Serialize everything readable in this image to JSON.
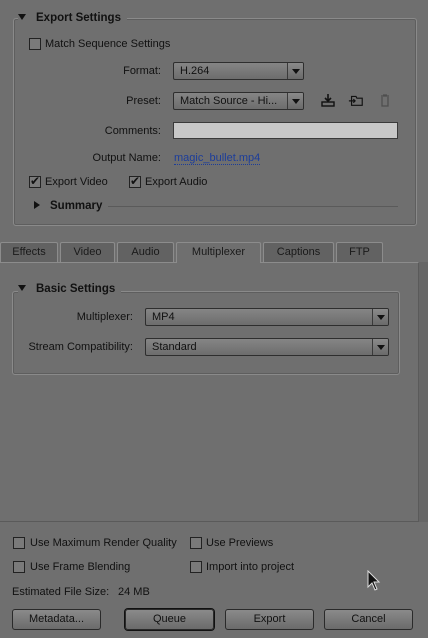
{
  "export_settings": {
    "title": "Export Settings",
    "match_sequence_label": "Match Sequence Settings",
    "match_sequence_checked": false,
    "format_label": "Format:",
    "format_value": "H.264",
    "preset_label": "Preset:",
    "preset_value": "Match Source - Hi...",
    "comments_label": "Comments:",
    "comments_value": "",
    "output_name_label": "Output Name:",
    "output_name_value": "magic_bullet.mp4",
    "export_video_label": "Export Video",
    "export_video_checked": true,
    "export_audio_label": "Export Audio",
    "export_audio_checked": true,
    "summary_label": "Summary"
  },
  "tabs": [
    {
      "label": "Effects",
      "active": false
    },
    {
      "label": "Video",
      "active": false
    },
    {
      "label": "Audio",
      "active": false
    },
    {
      "label": "Multiplexer",
      "active": true
    },
    {
      "label": "Captions",
      "active": false
    },
    {
      "label": "FTP",
      "active": false
    }
  ],
  "basic_settings": {
    "title": "Basic Settings",
    "multiplexer_label": "Multiplexer:",
    "multiplexer_value": "MP4",
    "stream_label": "Stream Compatibility:",
    "stream_value": "Standard"
  },
  "options": {
    "max_render_label": "Use Maximum Render Quality",
    "use_previews_label": "Use Previews",
    "frame_blending_label": "Use Frame Blending",
    "import_project_label": "Import into project",
    "file_size_label": "Estimated File Size:",
    "file_size_value": "24 MB"
  },
  "buttons": {
    "metadata": "Metadata...",
    "queue": "Queue",
    "export": "Export",
    "cancel": "Cancel"
  },
  "icons": {
    "save_preset": "save-preset-icon",
    "import_preset": "import-preset-icon",
    "delete_preset": "delete-preset-icon"
  }
}
